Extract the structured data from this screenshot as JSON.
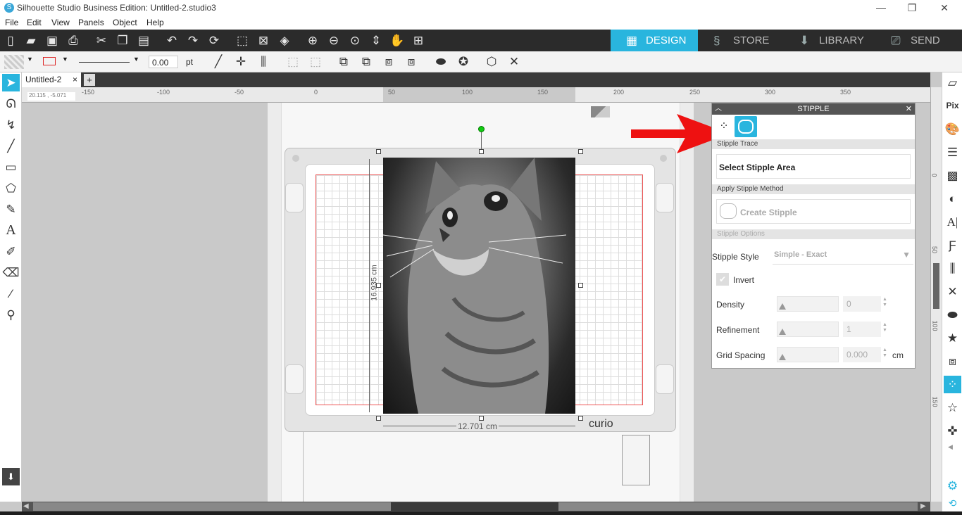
{
  "window": {
    "title": "Silhouette Studio Business Edition: Untitled-2.studio3",
    "minimize": "—",
    "restore": "❐",
    "close": "✕"
  },
  "menu": [
    "File",
    "Edit",
    "View",
    "Panels",
    "Object",
    "Help"
  ],
  "nav_tabs": [
    {
      "label": "DESIGN",
      "active": true
    },
    {
      "label": "STORE",
      "active": false
    },
    {
      "label": "LIBRARY",
      "active": false
    },
    {
      "label": "SEND",
      "active": false
    }
  ],
  "line_toolbar": {
    "line_width_value": "0.00",
    "line_width_unit": "pt"
  },
  "document": {
    "tab_label": "Untitled-2",
    "tab_close": "×",
    "add_tab": "+"
  },
  "ruler": {
    "coords": "20.115 , -5.071",
    "h_ticks": [
      "-150",
      "-100",
      "-50",
      "0",
      "50",
      "100",
      "150",
      "200",
      "250",
      "300",
      "350"
    ],
    "v_ticks": [
      "0",
      "50",
      "100",
      "150"
    ]
  },
  "canvas": {
    "height_dim": "16.935 cm",
    "width_dim": "12.701 cm",
    "mat_brand": "curio"
  },
  "stipple_panel": {
    "title": "STIPPLE",
    "sections": {
      "trace": "Stipple Trace",
      "method": "Apply Stipple Method",
      "options": "Stipple Options"
    },
    "select_area_button": "Select Stipple Area",
    "create_button": "Create Stipple",
    "style_label": "Stipple Style",
    "style_value": "Simple - Exact",
    "invert_label": "Invert",
    "invert_checked": true,
    "density_label": "Density",
    "density_value": "0",
    "refinement_label": "Refinement",
    "refinement_value": "1",
    "grid_spacing_label": "Grid Spacing",
    "grid_spacing_value": "0.000",
    "grid_spacing_unit": "cm"
  },
  "colors": {
    "accent": "#29b5de",
    "toolbar_dark": "#2b2b2b",
    "arrow_red": "#ee1111"
  }
}
